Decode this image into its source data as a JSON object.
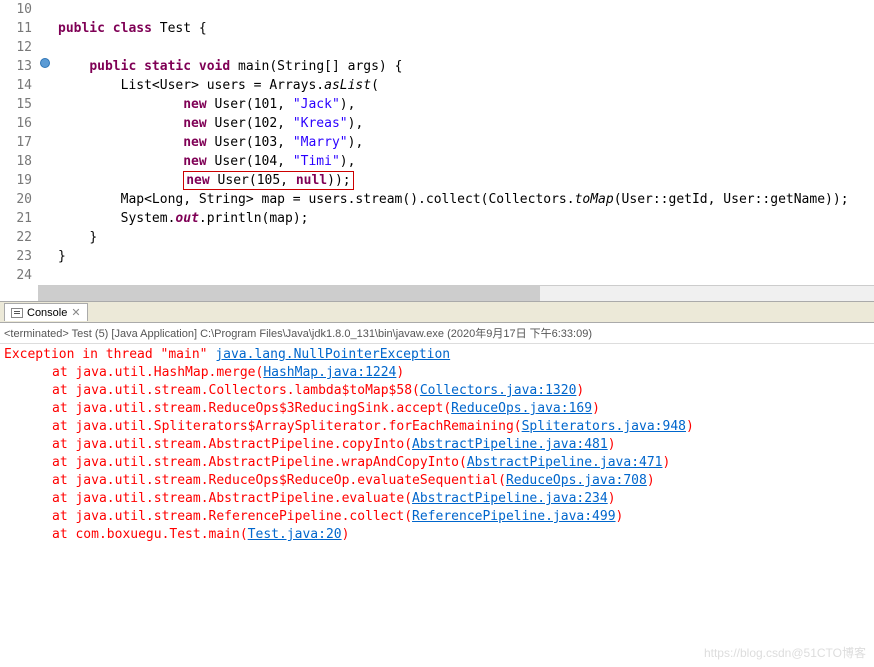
{
  "editor": {
    "lines": [
      10,
      11,
      12,
      13,
      14,
      15,
      16,
      17,
      18,
      19,
      20,
      21,
      22,
      23,
      24
    ],
    "tokens": {
      "public": "public",
      "class": "class",
      "static": "static",
      "void": "void",
      "new": "new",
      "null": "null",
      "class_name": "Test",
      "main": "main",
      "main_params": "(String[] args) {",
      "decl1": "List<User> users = Arrays.",
      "asList": "asList",
      "user": "User",
      "u1_id": "101",
      "u1_name": "\"Jack\"",
      "u2_id": "102",
      "u2_name": "\"Kreas\"",
      "u3_id": "103",
      "u3_name": "\"Marry\"",
      "u4_id": "104",
      "u4_name": "\"Timi\"",
      "u5_id": "105",
      "map_line": "Map<Long, String> map = users.stream().collect(Collectors.",
      "toMap": "toMap",
      "map_tail": "(User::getId, User::getName));",
      "sys_pre": "System.",
      "out": "out",
      "println_tail": ".println(map);"
    }
  },
  "console_tab": {
    "label": "Console"
  },
  "terminated": "<terminated> Test (5) [Java Application] C:\\Program Files\\Java\\jdk1.8.0_131\\bin\\javaw.exe (2020年9月17日 下午6:33:09)",
  "stack": {
    "head_pre": "Exception in thread \"main\" ",
    "head_link": "java.lang.NullPointerException",
    "rows": [
      {
        "pre": "at java.util.HashMap.merge(",
        "link": "HashMap.java:1224",
        "post": ")"
      },
      {
        "pre": "at java.util.stream.Collectors.lambda$toMap$58(",
        "link": "Collectors.java:1320",
        "post": ")"
      },
      {
        "pre": "at java.util.stream.ReduceOps$3ReducingSink.accept(",
        "link": "ReduceOps.java:169",
        "post": ")"
      },
      {
        "pre": "at java.util.Spliterators$ArraySpliterator.forEachRemaining(",
        "link": "Spliterators.java:948",
        "post": ")"
      },
      {
        "pre": "at java.util.stream.AbstractPipeline.copyInto(",
        "link": "AbstractPipeline.java:481",
        "post": ")"
      },
      {
        "pre": "at java.util.stream.AbstractPipeline.wrapAndCopyInto(",
        "link": "AbstractPipeline.java:471",
        "post": ")"
      },
      {
        "pre": "at java.util.stream.ReduceOps$ReduceOp.evaluateSequential(",
        "link": "ReduceOps.java:708",
        "post": ")"
      },
      {
        "pre": "at java.util.stream.AbstractPipeline.evaluate(",
        "link": "AbstractPipeline.java:234",
        "post": ")"
      },
      {
        "pre": "at java.util.stream.ReferencePipeline.collect(",
        "link": "ReferencePipeline.java:499",
        "post": ")"
      },
      {
        "pre": "at com.boxuegu.Test.main(",
        "link": "Test.java:20",
        "post": ")"
      }
    ]
  },
  "watermark": "https://blog.csdn@51CTO博客"
}
